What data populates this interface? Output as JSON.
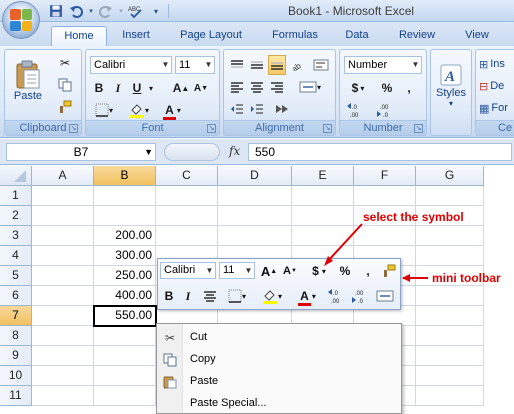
{
  "app": {
    "window_title": "Book1 - Microsoft Excel"
  },
  "quick_access": {
    "icons": [
      "save-icon",
      "undo-icon",
      "redo-icon",
      "spelling-icon",
      "customize-icon"
    ]
  },
  "ribbon": {
    "tabs": [
      {
        "label": "Home",
        "active": true
      },
      {
        "label": "Insert"
      },
      {
        "label": "Page Layout"
      },
      {
        "label": "Formulas"
      },
      {
        "label": "Data"
      },
      {
        "label": "Review"
      },
      {
        "label": "View"
      }
    ],
    "clipboard": {
      "label": "Clipboard",
      "paste_label": "Paste"
    },
    "font": {
      "label": "Font",
      "font_name": "Calibri",
      "font_size": "11",
      "bold": "B",
      "italic": "I",
      "underline": "U",
      "grow": "A",
      "shrink": "A"
    },
    "alignment": {
      "label": "Alignment"
    },
    "number": {
      "label": "Number",
      "format": "Number",
      "currency": "$",
      "percent": "%",
      "comma": ",",
      "inc_dec": ".0 .00",
      "dec_dec": ".00 .0"
    },
    "styles": {
      "label": "Styles"
    },
    "cells": {
      "label": "Ce",
      "insert": "Ins",
      "delete": "De",
      "format": "For"
    }
  },
  "formula_bar": {
    "name_box": "B7",
    "fx": "fx",
    "value": "550"
  },
  "grid": {
    "columns": [
      "A",
      "B",
      "C",
      "D",
      "E",
      "F",
      "G"
    ],
    "selected_column": "B",
    "rows": [
      "1",
      "2",
      "3",
      "4",
      "5",
      "6",
      "7",
      "8",
      "9",
      "10",
      "11"
    ],
    "selected_row": "7",
    "cells": {
      "B3": "200.00",
      "B4": "300.00",
      "B5": "250.00",
      "B6": "400.00",
      "B7": "550.00"
    }
  },
  "mini_toolbar": {
    "font_name": "Calibri",
    "font_size": "11",
    "grow": "A",
    "shrink": "A",
    "currency": "$",
    "percent": "%",
    "comma": ",",
    "bold": "B",
    "italic": "I",
    "inc_dec": "+.0",
    "dec_dec": ".00"
  },
  "context_menu": {
    "items": [
      {
        "label": "Cut",
        "icon": "scissors-icon"
      },
      {
        "label": "Copy",
        "icon": "copy-icon"
      },
      {
        "label": "Paste",
        "icon": "paste-icon"
      },
      {
        "label": "Paste Special...",
        "icon": ""
      }
    ]
  },
  "annotations": {
    "select_symbol": "select the symbol",
    "mini_toolbar": "mini toolbar"
  },
  "colors": {
    "annotation": "#e00000",
    "selected_header": "#f1c15f",
    "ribbon_blue": "#15428b"
  }
}
